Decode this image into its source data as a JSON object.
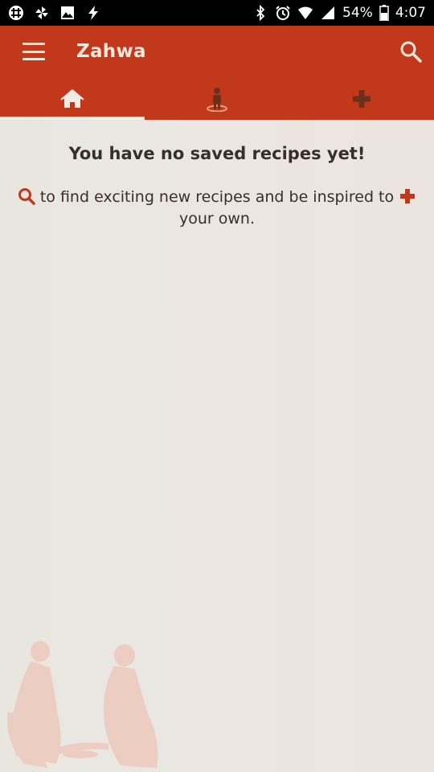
{
  "status_bar": {
    "battery": "54%",
    "time": "4:07"
  },
  "app_bar": {
    "title": "Zahwa"
  },
  "tabs": [
    {
      "icon": "home-icon",
      "active": true
    },
    {
      "icon": "person-icon",
      "active": false
    },
    {
      "icon": "plus-icon",
      "active": false
    }
  ],
  "empty_state": {
    "title": "You have no saved recipes yet!",
    "message": "to find exciting new recipes and be inspired to",
    "message_end": "your own."
  },
  "colors": {
    "primary": "#c1391a",
    "background": "#ebe5e0",
    "text": "#3a2e2a",
    "accent_icon": "#c1391a"
  }
}
